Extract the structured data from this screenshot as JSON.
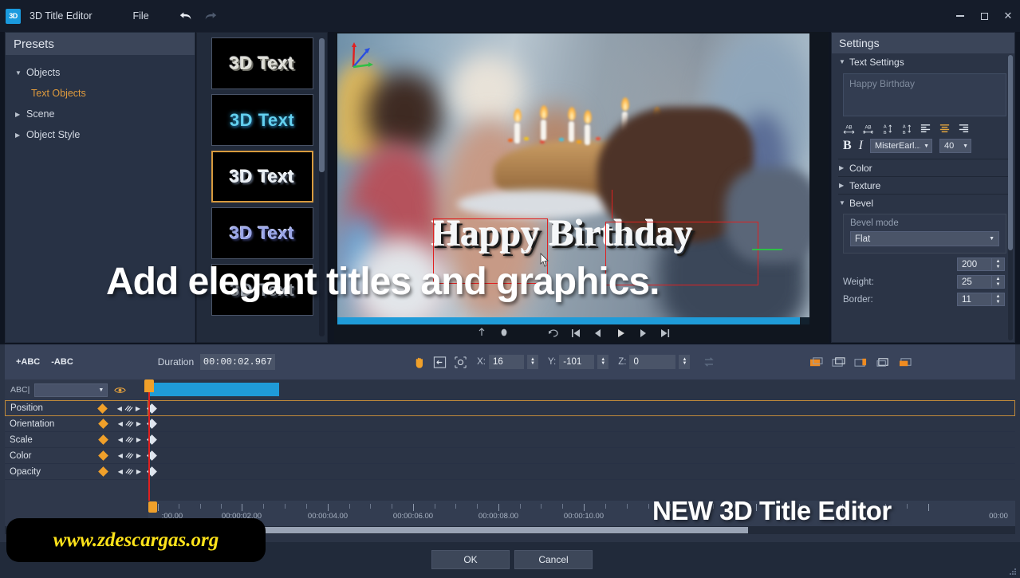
{
  "titlebar": {
    "app_badge": "3D",
    "title": "3D Title Editor",
    "menu_file": "File",
    "undo_icon": "undo-arrow-icon",
    "redo_icon": "redo-arrow-icon",
    "minimize": "–",
    "maximize": "□",
    "close": "✕"
  },
  "presets": {
    "header": "Presets",
    "items": [
      {
        "label": "Objects",
        "twisty": "▼",
        "child": false
      },
      {
        "label": "Text Objects",
        "twisty": "",
        "child": true
      },
      {
        "label": "Scene",
        "twisty": "▶",
        "child": false
      },
      {
        "label": "Object Style",
        "twisty": "▶",
        "child": false
      }
    ]
  },
  "thumbnails": {
    "items": [
      {
        "label": "3D Text",
        "style": "t1",
        "selected": false
      },
      {
        "label": "3D Text",
        "style": "t2",
        "selected": false
      },
      {
        "label": "3D Text",
        "style": "t3",
        "selected": true
      },
      {
        "label": "3D Text",
        "style": "t4",
        "selected": false
      },
      {
        "label": "3D Text",
        "style": "t5",
        "selected": false
      }
    ]
  },
  "preview": {
    "title_text": "Happy Birthday",
    "gizmo": "axis-gizmo-icon",
    "progress_pct": 98,
    "controls": [
      "mark-in-icon",
      "mark-out-icon",
      "loop-icon",
      "skip-start-icon",
      "step-back-icon",
      "play-icon",
      "step-forward-icon",
      "skip-end-icon"
    ]
  },
  "settings": {
    "header": "Settings",
    "text_settings": {
      "label": "Text Settings",
      "twisty": "▼",
      "textarea_value": "Happy Birthday",
      "icons": [
        "letter-spacing-expand-icon",
        "letter-spacing-condense-icon",
        "line-spacing-decrease-icon",
        "line-spacing-increase-icon",
        "align-left-icon",
        "align-center-icon",
        "align-right-icon"
      ],
      "bold": "B",
      "italic": "I",
      "font_family": "MisterEarl...",
      "font_size": "40"
    },
    "sections": [
      {
        "label": "Color",
        "twisty": "▶"
      },
      {
        "label": "Texture",
        "twisty": "▶"
      },
      {
        "label": "Bevel",
        "twisty": "▼"
      }
    ],
    "bevel": {
      "mode_label": "Bevel mode",
      "mode_value": "Flat",
      "fields": [
        {
          "label": "",
          "value": "200"
        },
        {
          "label": "Weight:",
          "value": "25"
        },
        {
          "label": "Border:",
          "value": "11"
        }
      ]
    }
  },
  "timeline_toolbar": {
    "add_text": "+ABC",
    "remove_text": "-ABC",
    "duration_label": "Duration",
    "duration_value": "00:00:02.967",
    "tools": [
      "pan-hand-icon",
      "move-object-icon",
      "rotate-object-icon"
    ],
    "axes": [
      {
        "label": "X:",
        "value": "16"
      },
      {
        "label": "Y:",
        "value": "-101"
      },
      {
        "label": "Z:",
        "value": "0"
      }
    ],
    "reset_icon": "reset-transform-icon",
    "layer_icons": [
      "bring-to-front-icon",
      "bring-forward-icon",
      "send-middle-icon",
      "send-backward-icon",
      "send-to-back-icon"
    ]
  },
  "track": {
    "object_label": "ABC|",
    "visibility_icon": "eye-icon",
    "properties": [
      {
        "name": "Position",
        "selected": true
      },
      {
        "name": "Orientation",
        "selected": false
      },
      {
        "name": "Scale",
        "selected": false
      },
      {
        "name": "Color",
        "selected": false
      },
      {
        "name": "Opacity",
        "selected": false
      }
    ]
  },
  "ruler": {
    "labels": [
      {
        "text": ":00.00",
        "pos": 12
      },
      {
        "text": "00:00:02.00",
        "pos": 117
      },
      {
        "text": "00:00:04.00",
        "pos": 225
      },
      {
        "text": "00:00:06.00",
        "pos": 332
      },
      {
        "text": "00:00:08.00",
        "pos": 439
      },
      {
        "text": "00:00:10.00",
        "pos": 546
      },
      {
        "text": "00:00",
        "pos": 660
      }
    ]
  },
  "footer": {
    "ok": "OK",
    "cancel": "Cancel"
  },
  "overlays": {
    "headline": "Add elegant titles and graphics.",
    "badge": "NEW 3D Title Editor",
    "watermark": "www.zdescargas.org"
  },
  "colors": {
    "accent_orange": "#f0a02a",
    "accent_blue": "#1f9bd8",
    "panel": "#2b3446",
    "panel_light": "#39435a",
    "titlebar": "#151c2a",
    "selection_red": "#e02020",
    "watermark_yellow": "#fde21a"
  }
}
